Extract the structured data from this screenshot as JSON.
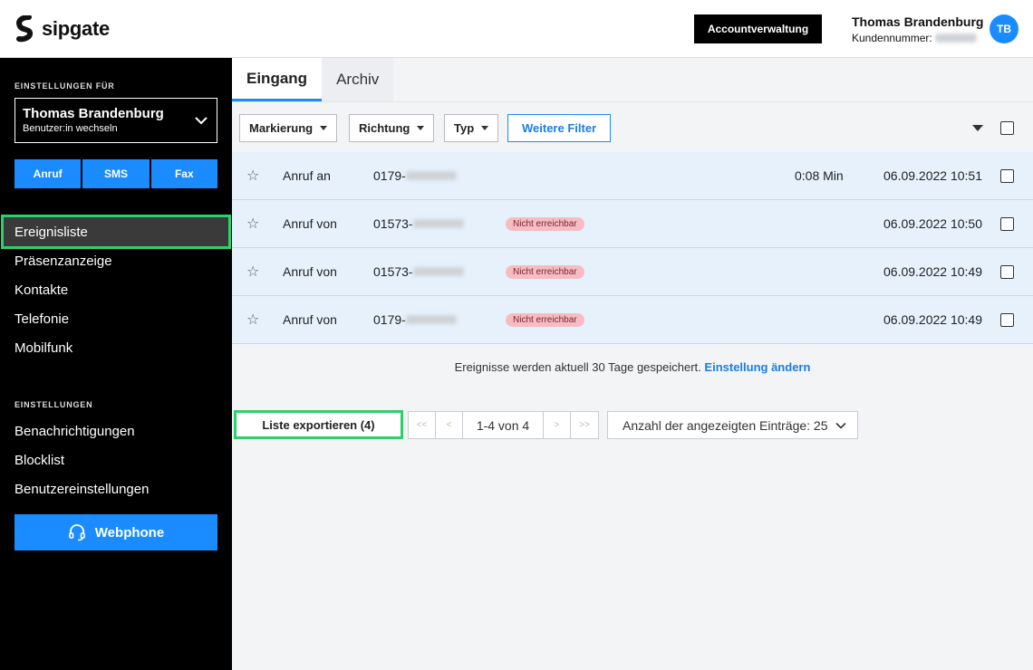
{
  "header": {
    "logo_text": "sipgate",
    "account_button": "Accountverwaltung",
    "user_name": "Thomas Brandenburg",
    "customer_label": "Kundennummer:",
    "avatar_initials": "TB"
  },
  "sidebar": {
    "settings_for_label": "EINSTELLUNGEN FÜR",
    "selected_user": "Thomas Brandenburg",
    "switch_user": "Benutzer:in wechseln",
    "quick_actions": [
      "Anruf",
      "SMS",
      "Fax"
    ],
    "nav": [
      "Ereignisliste",
      "Präsenzanzeige",
      "Kontakte",
      "Telefonie",
      "Mobilfunk"
    ],
    "settings_label": "EINSTELLUNGEN",
    "settings_nav": [
      "Benachrichtigungen",
      "Blocklist",
      "Benutzereinstellungen"
    ],
    "webphone_label": "Webphone"
  },
  "main": {
    "tabs": [
      "Eingang",
      "Archiv"
    ],
    "filters": [
      "Markierung",
      "Richtung",
      "Typ"
    ],
    "more_filters": "Weitere Filter",
    "rows": [
      {
        "type": "Anruf an",
        "number_prefix": "0179-",
        "badge": "",
        "duration": "0:08 Min",
        "date": "06.09.2022 10:51"
      },
      {
        "type": "Anruf von",
        "number_prefix": "01573-",
        "badge": "Nicht erreichbar",
        "duration": "",
        "date": "06.09.2022 10:50"
      },
      {
        "type": "Anruf von",
        "number_prefix": "01573-",
        "badge": "Nicht erreichbar",
        "duration": "",
        "date": "06.09.2022 10:49"
      },
      {
        "type": "Anruf von",
        "number_prefix": "0179-",
        "badge": "Nicht erreichbar",
        "duration": "",
        "date": "06.09.2022 10:49"
      }
    ],
    "info_text": "Ereignisse werden aktuell 30 Tage gespeichert.",
    "info_link": "Einstellung ändern",
    "export_button": "Liste exportieren (4)",
    "pager": {
      "first": "<<",
      "prev": "<",
      "label": "1-4 von 4",
      "next": ">",
      "last": ">>"
    },
    "per_page": "Anzahl der angezeigten Einträge: 25"
  },
  "colors": {
    "accent": "#1a8cff",
    "highlight": "#2ed06e",
    "badge": "#f7bcc3"
  }
}
